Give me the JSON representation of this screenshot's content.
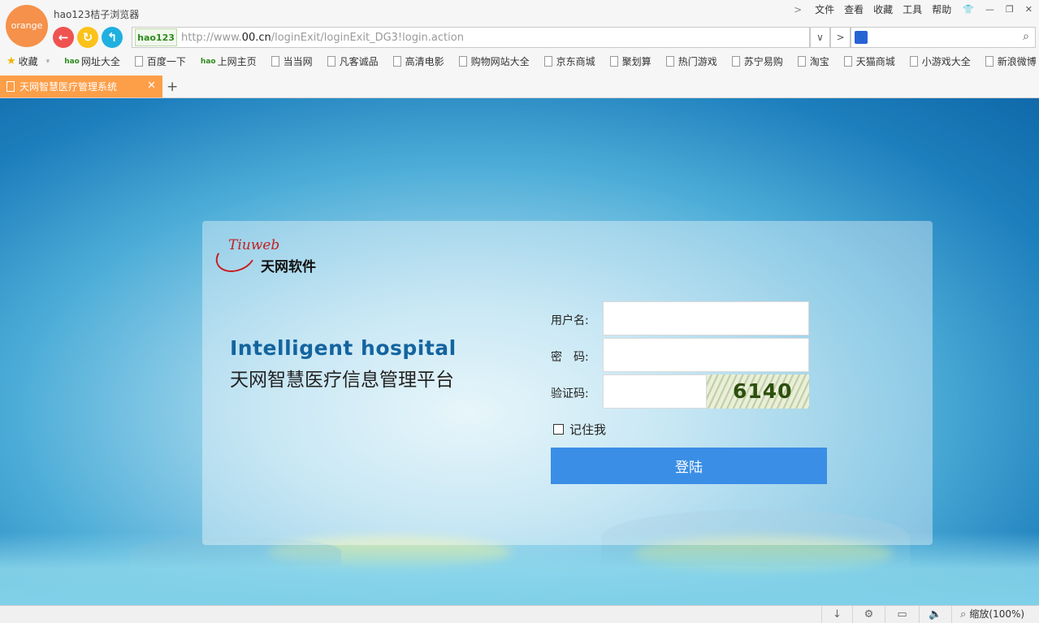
{
  "browser": {
    "logo_text": "orange",
    "title": "hao123桔子浏览器",
    "menu": [
      "文件",
      "查看",
      "收藏",
      "工具",
      "帮助"
    ],
    "address": {
      "badge": "hao123",
      "url_prefix": "http://www.",
      "url_domain": "00.cn",
      "url_path": "/loginExit/loginExit_DG3!login.action"
    },
    "bookmarks": [
      "收藏",
      "网址大全",
      "百度一下",
      "上网主页",
      "当当网",
      "凡客诚品",
      "高清电影",
      "购物网站大全",
      "京东商城",
      "聚划算",
      "热门游戏",
      "苏宁易购",
      "淘宝",
      "天猫商城",
      "小游戏大全",
      "新浪微博"
    ],
    "tab_title": "天网智慧医疗管理系统",
    "new_tab": "+",
    "zoom": "缩放(100%)"
  },
  "login": {
    "brand_en": "Tiuweb",
    "brand_cn": "天网软件",
    "heading_en": "Intelligent hospital",
    "heading_cn": "天网智慧医疗信息管理平台",
    "username_label": "用户名:",
    "password_label": "密　码:",
    "captcha_label": "验证码:",
    "captcha_code": "6140",
    "remember_label": "记住我",
    "submit_label": "登陆"
  },
  "colors": {
    "accent_orange": "#fd9e48",
    "login_button": "#3a8ee6",
    "heading_blue": "#14649f"
  }
}
